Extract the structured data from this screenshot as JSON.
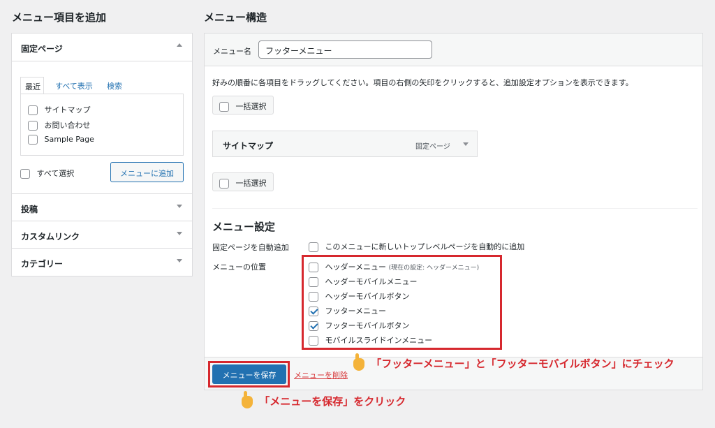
{
  "left": {
    "title": "メニュー項目を追加",
    "pages_section": "固定ページ",
    "tabs": [
      "最近",
      "すべて表示",
      "検索"
    ],
    "pages": [
      "サイトマップ",
      "お問い合わせ",
      "Sample Page"
    ],
    "select_all": "すべて選択",
    "add_button": "メニューに追加",
    "sections": [
      "投稿",
      "カスタムリンク",
      "カテゴリー"
    ]
  },
  "right": {
    "title": "メニュー構造",
    "menu_name_label": "メニュー名",
    "menu_name_value": "フッターメニュー",
    "instructions": "好みの順番に各項目をドラッグしてください。項目の右側の矢印をクリックすると、追加設定オプションを表示できます。",
    "bulk_select": "一括選択",
    "menu_item": {
      "title": "サイトマップ",
      "type": "固定ページ"
    },
    "settings_title": "メニュー設定",
    "auto_add_label": "固定ページを自動追加",
    "auto_add_option": "このメニューに新しいトップレベルページを自動的に追加",
    "location_label": "メニューの位置",
    "locations": [
      {
        "name": "ヘッダーメニュー",
        "note": "(現在の設定: ヘッダーメニュー)",
        "checked": false
      },
      {
        "name": "ヘッダーモバイルメニュー",
        "note": "",
        "checked": false
      },
      {
        "name": "ヘッダーモバイルボタン",
        "note": "",
        "checked": false
      },
      {
        "name": "フッターメニュー",
        "note": "",
        "checked": true
      },
      {
        "name": "フッターモバイルボタン",
        "note": "",
        "checked": true
      },
      {
        "name": "モバイルスライドインメニュー",
        "note": "",
        "checked": false
      }
    ],
    "save_button": "メニューを保存",
    "delete_link": "メニューを削除"
  },
  "annotations": {
    "check_note": "「フッターメニュー」と「フッターモバイルボタン」にチェック",
    "save_note": "「メニューを保存」をクリック",
    "highlight_color": "#d6282e"
  }
}
